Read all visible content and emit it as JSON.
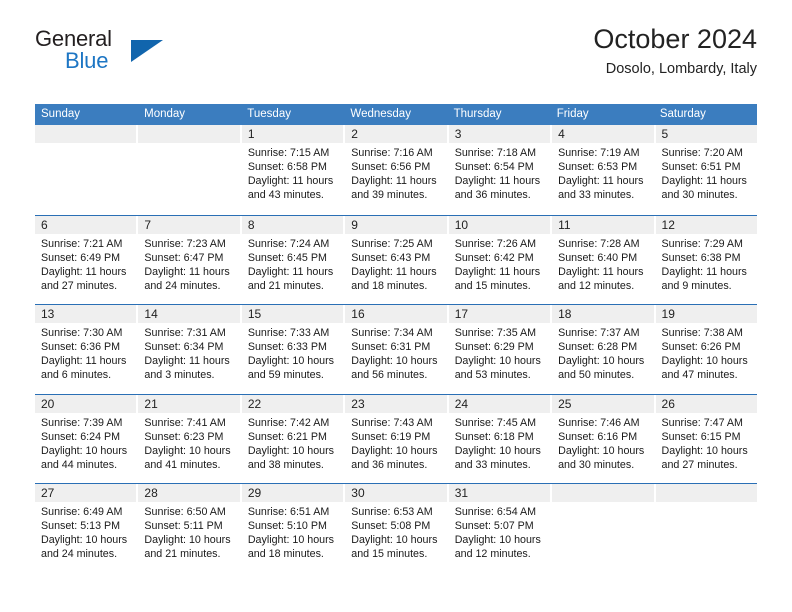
{
  "brand": {
    "line1": "General",
    "line2": "Blue",
    "triangle_color": "#1165ad",
    "blue_text_color": "#1d76c4"
  },
  "header": {
    "title": "October 2024",
    "subtitle": "Dosolo, Lombardy, Italy"
  },
  "theme": {
    "header_row_bg": "#3b7dbf",
    "week_divider": "#2a6fb5",
    "date_band_bg": "#efefef"
  },
  "weekday_headers": [
    "Sunday",
    "Monday",
    "Tuesday",
    "Wednesday",
    "Thursday",
    "Friday",
    "Saturday"
  ],
  "weeks": [
    [
      {
        "day": "",
        "lines": [
          "",
          "",
          "",
          ""
        ]
      },
      {
        "day": "",
        "lines": [
          "",
          "",
          "",
          ""
        ]
      },
      {
        "day": "1",
        "lines": [
          "Sunrise: 7:15 AM",
          "Sunset: 6:58 PM",
          "Daylight: 11 hours",
          "and 43 minutes."
        ]
      },
      {
        "day": "2",
        "lines": [
          "Sunrise: 7:16 AM",
          "Sunset: 6:56 PM",
          "Daylight: 11 hours",
          "and 39 minutes."
        ]
      },
      {
        "day": "3",
        "lines": [
          "Sunrise: 7:18 AM",
          "Sunset: 6:54 PM",
          "Daylight: 11 hours",
          "and 36 minutes."
        ]
      },
      {
        "day": "4",
        "lines": [
          "Sunrise: 7:19 AM",
          "Sunset: 6:53 PM",
          "Daylight: 11 hours",
          "and 33 minutes."
        ]
      },
      {
        "day": "5",
        "lines": [
          "Sunrise: 7:20 AM",
          "Sunset: 6:51 PM",
          "Daylight: 11 hours",
          "and 30 minutes."
        ]
      }
    ],
    [
      {
        "day": "6",
        "lines": [
          "Sunrise: 7:21 AM",
          "Sunset: 6:49 PM",
          "Daylight: 11 hours",
          "and 27 minutes."
        ]
      },
      {
        "day": "7",
        "lines": [
          "Sunrise: 7:23 AM",
          "Sunset: 6:47 PM",
          "Daylight: 11 hours",
          "and 24 minutes."
        ]
      },
      {
        "day": "8",
        "lines": [
          "Sunrise: 7:24 AM",
          "Sunset: 6:45 PM",
          "Daylight: 11 hours",
          "and 21 minutes."
        ]
      },
      {
        "day": "9",
        "lines": [
          "Sunrise: 7:25 AM",
          "Sunset: 6:43 PM",
          "Daylight: 11 hours",
          "and 18 minutes."
        ]
      },
      {
        "day": "10",
        "lines": [
          "Sunrise: 7:26 AM",
          "Sunset: 6:42 PM",
          "Daylight: 11 hours",
          "and 15 minutes."
        ]
      },
      {
        "day": "11",
        "lines": [
          "Sunrise: 7:28 AM",
          "Sunset: 6:40 PM",
          "Daylight: 11 hours",
          "and 12 minutes."
        ]
      },
      {
        "day": "12",
        "lines": [
          "Sunrise: 7:29 AM",
          "Sunset: 6:38 PM",
          "Daylight: 11 hours",
          "and 9 minutes."
        ]
      }
    ],
    [
      {
        "day": "13",
        "lines": [
          "Sunrise: 7:30 AM",
          "Sunset: 6:36 PM",
          "Daylight: 11 hours",
          "and 6 minutes."
        ]
      },
      {
        "day": "14",
        "lines": [
          "Sunrise: 7:31 AM",
          "Sunset: 6:34 PM",
          "Daylight: 11 hours",
          "and 3 minutes."
        ]
      },
      {
        "day": "15",
        "lines": [
          "Sunrise: 7:33 AM",
          "Sunset: 6:33 PM",
          "Daylight: 10 hours",
          "and 59 minutes."
        ]
      },
      {
        "day": "16",
        "lines": [
          "Sunrise: 7:34 AM",
          "Sunset: 6:31 PM",
          "Daylight: 10 hours",
          "and 56 minutes."
        ]
      },
      {
        "day": "17",
        "lines": [
          "Sunrise: 7:35 AM",
          "Sunset: 6:29 PM",
          "Daylight: 10 hours",
          "and 53 minutes."
        ]
      },
      {
        "day": "18",
        "lines": [
          "Sunrise: 7:37 AM",
          "Sunset: 6:28 PM",
          "Daylight: 10 hours",
          "and 50 minutes."
        ]
      },
      {
        "day": "19",
        "lines": [
          "Sunrise: 7:38 AM",
          "Sunset: 6:26 PM",
          "Daylight: 10 hours",
          "and 47 minutes."
        ]
      }
    ],
    [
      {
        "day": "20",
        "lines": [
          "Sunrise: 7:39 AM",
          "Sunset: 6:24 PM",
          "Daylight: 10 hours",
          "and 44 minutes."
        ]
      },
      {
        "day": "21",
        "lines": [
          "Sunrise: 7:41 AM",
          "Sunset: 6:23 PM",
          "Daylight: 10 hours",
          "and 41 minutes."
        ]
      },
      {
        "day": "22",
        "lines": [
          "Sunrise: 7:42 AM",
          "Sunset: 6:21 PM",
          "Daylight: 10 hours",
          "and 38 minutes."
        ]
      },
      {
        "day": "23",
        "lines": [
          "Sunrise: 7:43 AM",
          "Sunset: 6:19 PM",
          "Daylight: 10 hours",
          "and 36 minutes."
        ]
      },
      {
        "day": "24",
        "lines": [
          "Sunrise: 7:45 AM",
          "Sunset: 6:18 PM",
          "Daylight: 10 hours",
          "and 33 minutes."
        ]
      },
      {
        "day": "25",
        "lines": [
          "Sunrise: 7:46 AM",
          "Sunset: 6:16 PM",
          "Daylight: 10 hours",
          "and 30 minutes."
        ]
      },
      {
        "day": "26",
        "lines": [
          "Sunrise: 7:47 AM",
          "Sunset: 6:15 PM",
          "Daylight: 10 hours",
          "and 27 minutes."
        ]
      }
    ],
    [
      {
        "day": "27",
        "lines": [
          "Sunrise: 6:49 AM",
          "Sunset: 5:13 PM",
          "Daylight: 10 hours",
          "and 24 minutes."
        ]
      },
      {
        "day": "28",
        "lines": [
          "Sunrise: 6:50 AM",
          "Sunset: 5:11 PM",
          "Daylight: 10 hours",
          "and 21 minutes."
        ]
      },
      {
        "day": "29",
        "lines": [
          "Sunrise: 6:51 AM",
          "Sunset: 5:10 PM",
          "Daylight: 10 hours",
          "and 18 minutes."
        ]
      },
      {
        "day": "30",
        "lines": [
          "Sunrise: 6:53 AM",
          "Sunset: 5:08 PM",
          "Daylight: 10 hours",
          "and 15 minutes."
        ]
      },
      {
        "day": "31",
        "lines": [
          "Sunrise: 6:54 AM",
          "Sunset: 5:07 PM",
          "Daylight: 10 hours",
          "and 12 minutes."
        ]
      },
      {
        "day": "",
        "lines": [
          "",
          "",
          "",
          ""
        ]
      },
      {
        "day": "",
        "lines": [
          "",
          "",
          "",
          ""
        ]
      }
    ]
  ]
}
